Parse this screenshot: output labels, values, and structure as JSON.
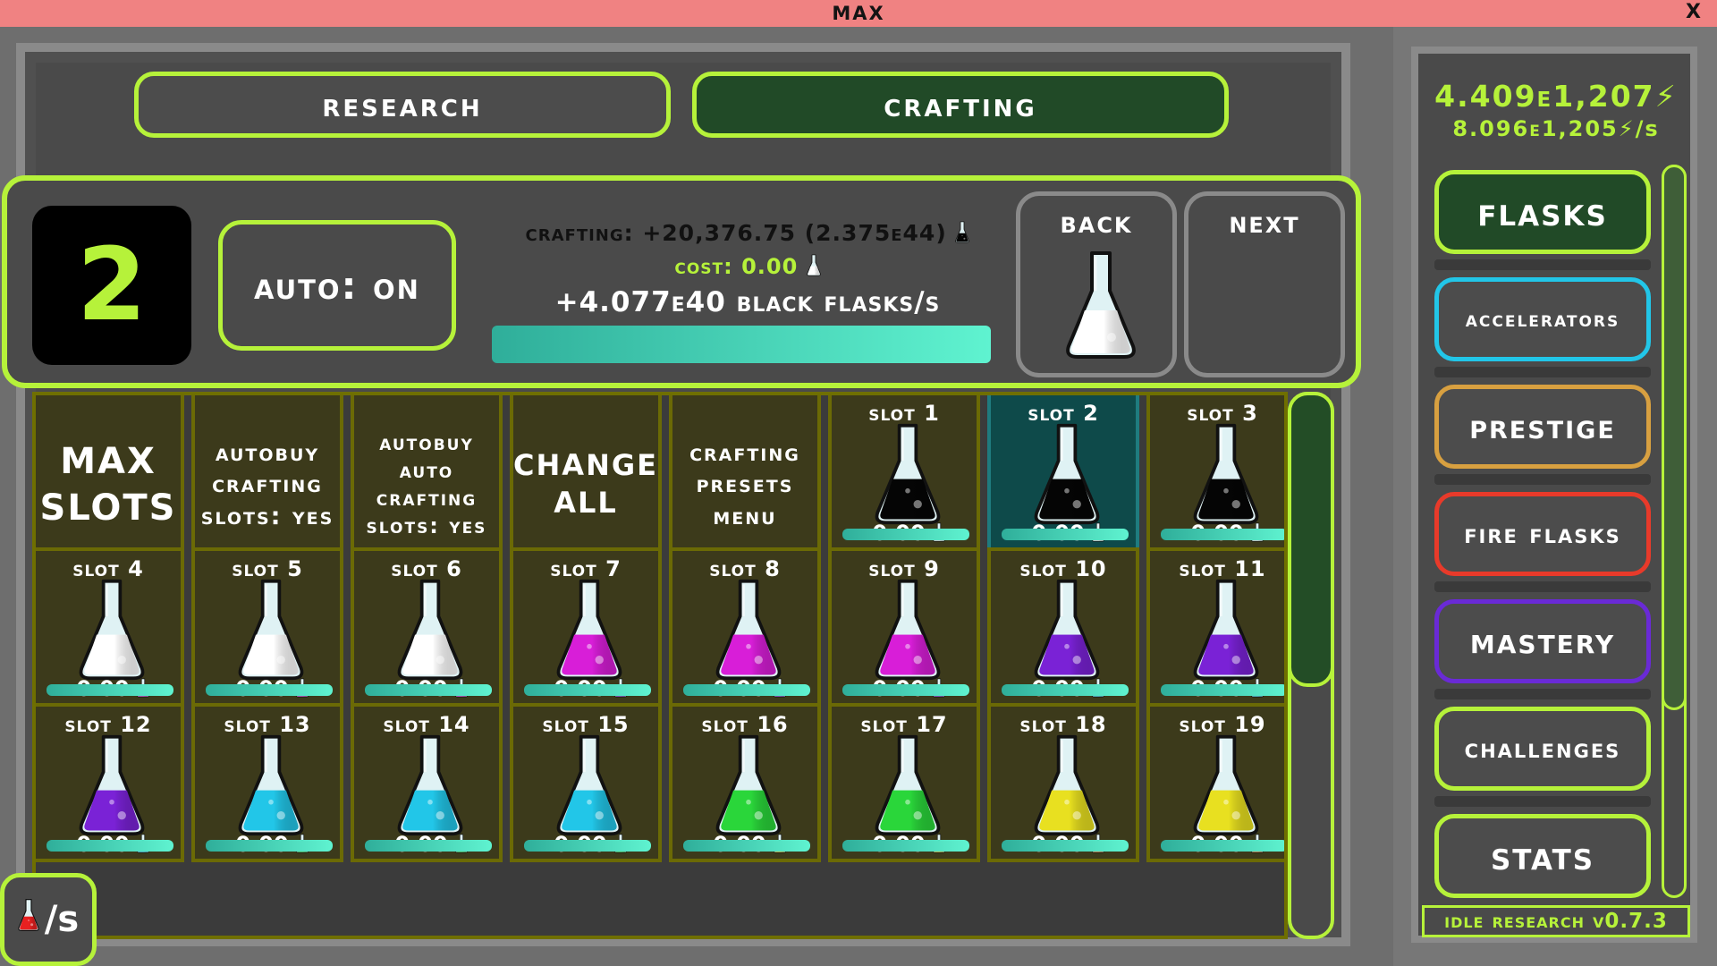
{
  "window": {
    "title": "MAX",
    "close_label": "X"
  },
  "tabs": {
    "research": "Research",
    "crafting": "Crafting"
  },
  "craft": {
    "slot_number": "2",
    "auto_label": "Auto: On",
    "crafting_text": "Crafting: +20,376.75 (2.375e44)",
    "cost_text": "Cost: 0.00",
    "rate_text": "+4.077e40 Black Flasks/s",
    "progress": 1.0,
    "back_label": "Back",
    "next_label": "Next",
    "back_flask_color": "#ffffff"
  },
  "actions": [
    {
      "label": "MAX SLOTS",
      "name": "max-slots-button",
      "size": 40
    },
    {
      "label": "Autobuy Crafting Slots: Yes",
      "name": "autobuy-crafting-slots-button",
      "size": 27
    },
    {
      "label": "Autobuy Auto Crafting Slots: Yes",
      "name": "autobuy-auto-crafting-slots-button",
      "size": 24
    },
    {
      "label": "CHANGE ALL",
      "name": "change-all-button",
      "size": 32
    },
    {
      "label": "Crafting Presets Menu",
      "name": "crafting-presets-menu-button",
      "size": 27
    }
  ],
  "slots": [
    {
      "label": "Slot 1",
      "value": "-0.00",
      "flask": "#050505",
      "cost": "#ffffff",
      "selected": false
    },
    {
      "label": "Slot 2",
      "value": "-0.00",
      "flask": "#050505",
      "cost": "#ffffff",
      "selected": true
    },
    {
      "label": "Slot 3",
      "value": "-0.00",
      "flask": "#050505",
      "cost": "#ffffff",
      "selected": false
    },
    {
      "label": "Slot 4",
      "value": "-0.00",
      "flask": "#ffffff",
      "cost": "#d81ed8",
      "selected": false
    },
    {
      "label": "Slot 5",
      "value": "-0.00",
      "flask": "#ffffff",
      "cost": "#d81ed8",
      "selected": false
    },
    {
      "label": "Slot 6",
      "value": "-0.00",
      "flask": "#ffffff",
      "cost": "#d81ed8",
      "selected": false
    },
    {
      "label": "Slot 7",
      "value": "-0.00",
      "flask": "#d81ed8",
      "cost": "#7a22d6",
      "selected": false
    },
    {
      "label": "Slot 8",
      "value": "-0.00",
      "flask": "#d81ed8",
      "cost": "#7a22d6",
      "selected": false
    },
    {
      "label": "Slot 9",
      "value": "-0.00",
      "flask": "#d81ed8",
      "cost": "#7a22d6",
      "selected": false
    },
    {
      "label": "Slot 10",
      "value": "-0.00",
      "flask": "#7a22d6",
      "cost": "#22c6e8",
      "selected": false
    },
    {
      "label": "Slot 11",
      "value": "-0.00",
      "flask": "#7a22d6",
      "cost": "#22c6e8",
      "selected": false
    },
    {
      "label": "Slot 12",
      "value": "-0.00",
      "flask": "#7a22d6",
      "cost": "#22c6e8",
      "selected": false
    },
    {
      "label": "Slot 13",
      "value": "-0.00",
      "flask": "#22c6e8",
      "cost": "#2ad63a",
      "selected": false
    },
    {
      "label": "Slot 14",
      "value": "-0.00",
      "flask": "#22c6e8",
      "cost": "#2ad63a",
      "selected": false
    },
    {
      "label": "Slot 15",
      "value": "-0.00",
      "flask": "#22c6e8",
      "cost": "#2ad63a",
      "selected": false
    },
    {
      "label": "Slot 16",
      "value": "-0.00",
      "flask": "#2ad63a",
      "cost": "#e8e020",
      "selected": false
    },
    {
      "label": "Slot 17",
      "value": "-0.00",
      "flask": "#2ad63a",
      "cost": "#e8e020",
      "selected": false
    },
    {
      "label": "Slot 18",
      "value": "-0.00",
      "flask": "#e8e020",
      "cost": "#f07f1e",
      "selected": false
    },
    {
      "label": "Slot 19",
      "value": "-0.00",
      "flask": "#e8e020",
      "cost": "#f07f1e",
      "selected": false
    }
  ],
  "per_second_label": "/s",
  "currency": {
    "total": "4.409e1,207",
    "rate": "8.096e1,205",
    "rate_suffix": "/s"
  },
  "sidebar": [
    {
      "label": "Flasks",
      "name": "flasks-button",
      "border": "#b6f23a",
      "bg": "#214a27",
      "size": 44
    },
    {
      "label": "Accelerators",
      "name": "accelerators-button",
      "border": "#22c6e8",
      "bg": "#4c4c4c",
      "size": 24
    },
    {
      "label": "Prestige",
      "name": "prestige-button",
      "border": "#d8a040",
      "bg": "#4c4c4c",
      "size": 38
    },
    {
      "label": "Fire Flasks",
      "name": "fire-flasks-button",
      "border": "#e83a2a",
      "bg": "#4c4c4c",
      "size": 30
    },
    {
      "label": "Mastery",
      "name": "mastery-button",
      "border": "#6a2ad6",
      "bg": "#4c4c4c",
      "size": 40
    },
    {
      "label": "Challenges",
      "name": "challenges-button",
      "border": "#b6f23a",
      "bg": "#4c4c4c",
      "size": 30
    },
    {
      "label": "Stats",
      "name": "stats-button",
      "border": "#b6f23a",
      "bg": "#4c4c4c",
      "size": 44
    }
  ],
  "version": "Idle Research v0.7.3",
  "colors": {
    "accent": "#b6f23a",
    "title_bar": "#f08282"
  }
}
